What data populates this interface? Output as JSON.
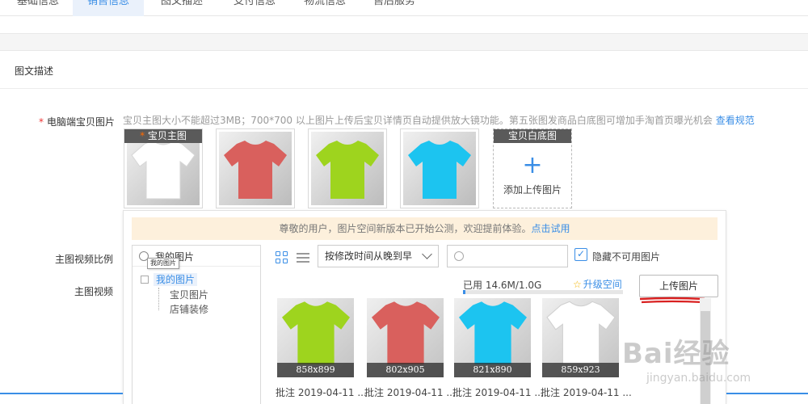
{
  "tabs": [
    {
      "label": "基础信息"
    },
    {
      "label": "销售信息"
    },
    {
      "label": "图文描述"
    },
    {
      "label": "支付信息"
    },
    {
      "label": "物流信息"
    },
    {
      "label": "售后服务"
    }
  ],
  "section": {
    "title": "图文描述"
  },
  "form": {
    "required_mark": "*",
    "pc_images_label": "电脑端宝贝图片",
    "pc_images_hint": "宝贝主图大小不能超过3MB；700*700 以上图片上传后宝贝详情页自动提供放大镜功能。第五张图发商品白底图可增加手淘首页曝光机会",
    "pc_images_link": "查看规范",
    "video_ratio_label": "主图视频比例",
    "video_label": "主图视频"
  },
  "slots": [
    {
      "header": "宝贝主图",
      "required": "*",
      "color": "#ffffff"
    },
    {
      "color": "#d9605d"
    },
    {
      "color": "#9ed41e"
    },
    {
      "color": "#1cc4f0"
    },
    {
      "header": "宝贝白底图",
      "add_text": "添加上传图片",
      "plus": "+"
    }
  ],
  "image_space": {
    "notice_text": "尊敬的用户，图片空间新版本已开始公测，欢迎提前体验。",
    "notice_link": "点击试用",
    "tree_search_value": "我的图片",
    "tooltip": "我的图片",
    "tree": {
      "root": "我的图片",
      "children": [
        "宝贝图片",
        "店铺装修"
      ]
    },
    "sort_selected": "按修改时间从晚到早",
    "hide_unavailable_label": "隐藏不可用图片",
    "hide_unavailable_checked": "✓",
    "usage_text": "已用 14.6M/1.0G",
    "usage_fraction": 0.014,
    "upgrade_label": "升级空间",
    "upload_button": "上传图片",
    "accent_color": "#3a8ee6",
    "annotation_color": "#d92020",
    "thumbnails": [
      {
        "size": "858x899",
        "caption": "批注 2019-04-11 ...",
        "color": "#9ed41e"
      },
      {
        "size": "802x905",
        "caption": "批注 2019-04-11 ...",
        "color": "#d9605d"
      },
      {
        "size": "821x890",
        "caption": "批注 2019-04-11 ...",
        "color": "#1cc4f0"
      },
      {
        "size": "859x923",
        "caption": "批注 2019-04-11 ...",
        "color": "#ffffff"
      }
    ]
  },
  "watermark": {
    "logo": "Bai经验",
    "url": "jingyan.baidu.com"
  }
}
